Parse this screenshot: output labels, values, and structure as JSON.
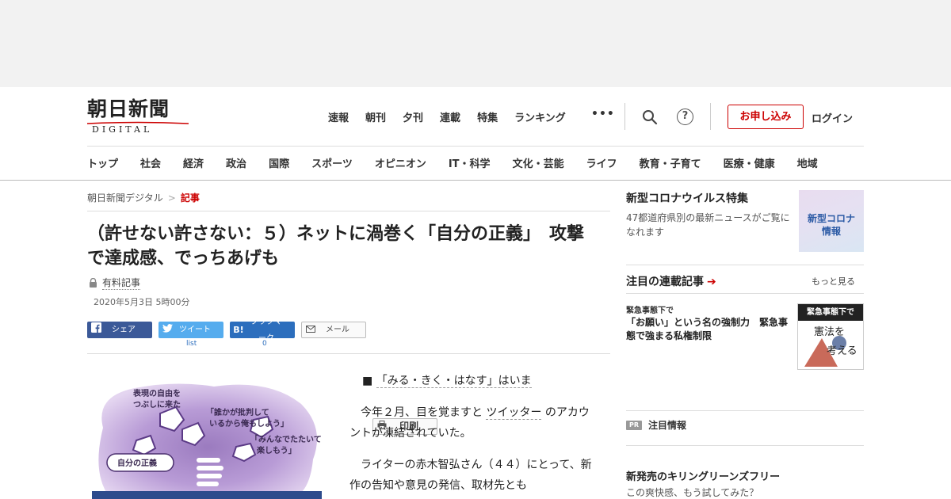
{
  "site": {
    "logo_jp": "朝日新聞",
    "logo_en": "DIGITAL"
  },
  "topnav": {
    "items": [
      "速報",
      "朝刊",
      "夕刊",
      "連載",
      "特集",
      "ランキング"
    ],
    "more": "•••",
    "subscribe_label": "お申し込み",
    "login_label": "ログイン",
    "help_glyph": "?"
  },
  "catnav": {
    "items": [
      "トップ",
      "社会",
      "経済",
      "政治",
      "国際",
      "スポーツ",
      "オピニオン",
      "IT・科学",
      "文化・芸能",
      "ライフ",
      "教育・子育て",
      "医療・健康",
      "地域"
    ]
  },
  "breadcrumb": {
    "home": "朝日新聞デジタル",
    "sep": ">",
    "current": "記事"
  },
  "article": {
    "title": "（許せない許さない：５）ネットに渦巻く「自分の正義」　攻撃で達成感、でっちあげも",
    "paid_label": "有料記事",
    "date": "2020年5月3日 5時00分",
    "share": {
      "facebook": "シェア",
      "twitter": "ツイート",
      "twitter_count": "list",
      "hatena_icon": "B!",
      "hatena": "ブックマーク",
      "hatena_count": "0",
      "mail": "メール",
      "print": "印刷"
    },
    "subheading_mark": "■",
    "subheading": "「みる・きく・はなす」はいま",
    "p1_a": "今年２月、目を覚ますと",
    "p1_link": "ツイッター",
    "p1_b": "のアカウントが凍結されていた。",
    "p2": "ライターの赤木智弘さん（４４）にとって、新作の告知や意見の発信、取材先とも"
  },
  "illustration": {
    "labels": [
      "表現の自由を",
      "つぶしに来た",
      "「誰かが批判して",
      "いるから俺もしよう」",
      "「みんなでたたいて",
      "楽しもう」",
      "自分の正義"
    ]
  },
  "sidebar": {
    "corona_title": "新型コロナウイルス特集",
    "corona_desc": "47都道府県別の最新ニュースがご覧になれます",
    "corona_thumb": [
      "新型コロナ",
      "情報"
    ],
    "series_title": "注目の連載記事",
    "series_arrow": "➔",
    "more": "もっと見る",
    "series_sub": "緊急事態下で",
    "series_head": "「お願い」という名の強制力　緊急事態で強まる私権制限",
    "series_thumb_bar": "緊急事態下で",
    "series_thumb_text": [
      "憲法を",
      "考える"
    ],
    "pr_badge": "PR",
    "pr_label": "注目情報",
    "ad_title": "新発売のキリングリーンズフリー",
    "ad_desc": "この爽快感、もう試してみた？"
  }
}
